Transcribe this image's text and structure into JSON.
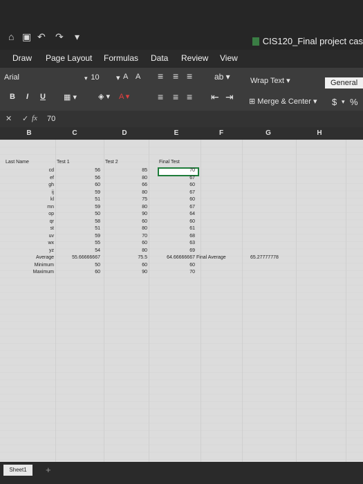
{
  "titlebar": {
    "quick_access": [
      "⌂",
      "▣",
      "↶",
      "↷",
      "▾"
    ],
    "doc_title": "CIS120_Final project cas"
  },
  "tabs": [
    "Draw",
    "Page Layout",
    "Formulas",
    "Data",
    "Review",
    "View"
  ],
  "ribbon": {
    "font": "Arial",
    "size": "10",
    "bold": "B",
    "italic": "I",
    "underline": "U",
    "wrap_text": "Wrap Text",
    "merge_center": "Merge & Center",
    "number_format": "General",
    "currency": "$",
    "percent": "%"
  },
  "formula_bar": {
    "fx": "fx",
    "value": "70"
  },
  "columns": [
    "B",
    "C",
    "D",
    "E",
    "F",
    "G",
    "H"
  ],
  "sheet": {
    "headers": {
      "c1": "Last Name",
      "c2": "Test 1",
      "c3": "Test 2",
      "c4": "Final Test"
    },
    "rows": [
      [
        "cd",
        "56",
        "85",
        "70"
      ],
      [
        "ef",
        "56",
        "80",
        "67"
      ],
      [
        "gh",
        "60",
        "66",
        "60"
      ],
      [
        "ij",
        "59",
        "80",
        "67"
      ],
      [
        "kl",
        "51",
        "75",
        "60"
      ],
      [
        "mn",
        "59",
        "80",
        "67"
      ],
      [
        "op",
        "50",
        "90",
        "64"
      ],
      [
        "qr",
        "58",
        "60",
        "60"
      ],
      [
        "st",
        "51",
        "80",
        "61"
      ],
      [
        "uv",
        "59",
        "70",
        "68"
      ],
      [
        "wx",
        "55",
        "60",
        "63"
      ],
      [
        "yz",
        "54",
        "80",
        "69"
      ]
    ],
    "summary": [
      {
        "label": "Average",
        "c": "55.66666667",
        "d": "75.5",
        "e": "64.66666667",
        "f": "Final Average",
        "g": "65.27777778"
      },
      {
        "label": "Minimum",
        "c": "50",
        "d": "60",
        "e": "60"
      },
      {
        "label": "Maximum",
        "c": "60",
        "d": "90",
        "e": "70"
      }
    ]
  },
  "status": {
    "sheet_tab": "Sheet1",
    "add": "+"
  }
}
